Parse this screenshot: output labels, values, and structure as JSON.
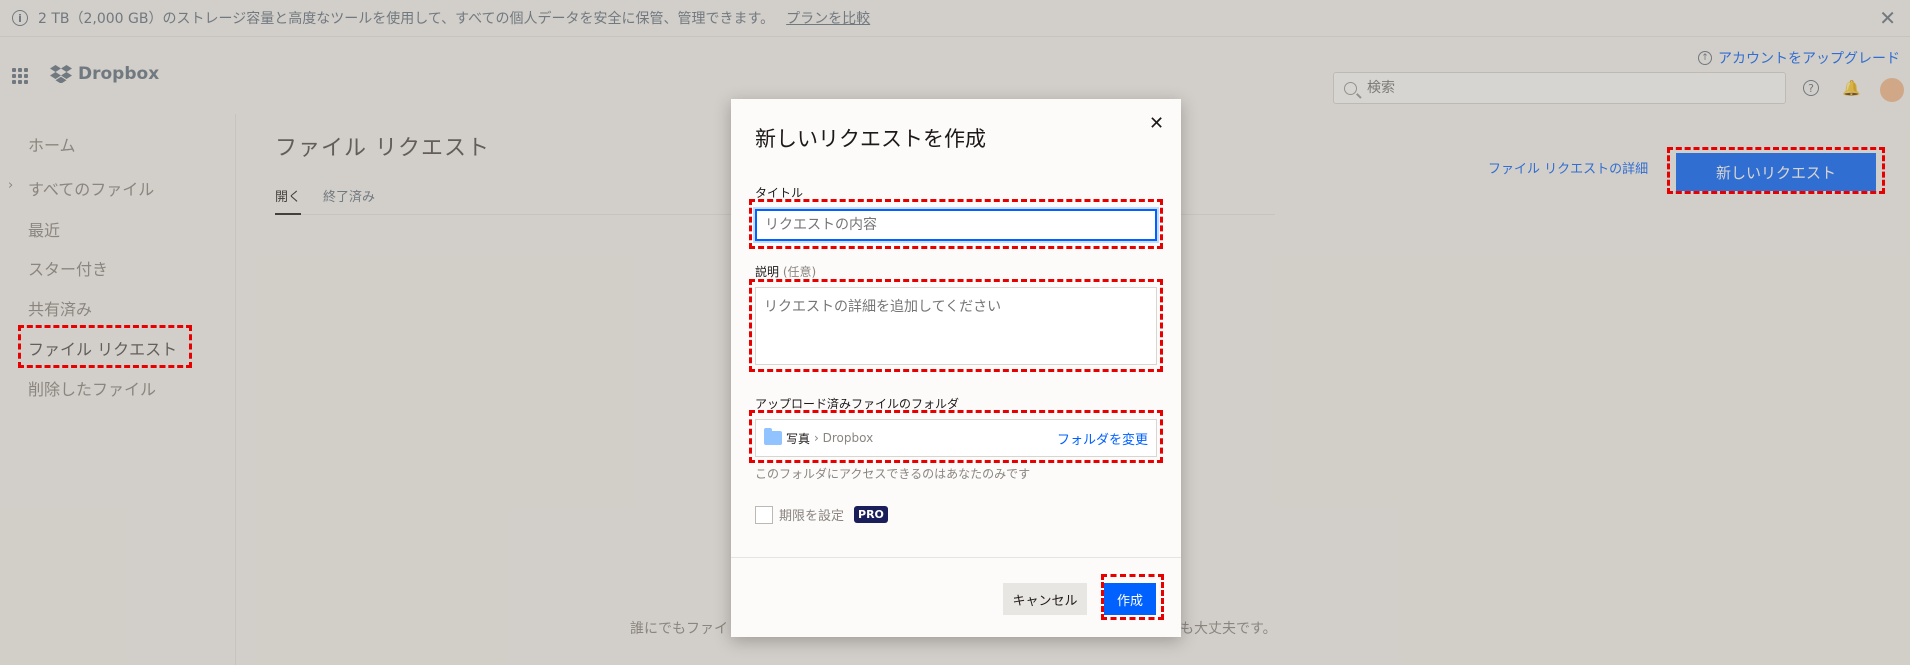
{
  "banner": {
    "text": "2 TB（2,000 GB）のストレージ容量と高度なツールを使用して、すべての個人データを安全に保管、管理できます。",
    "link": "プランを比較",
    "close": "✕"
  },
  "header": {
    "logo": "Dropbox",
    "upgrade": "アカウントをアップグレード",
    "search_placeholder": "検索"
  },
  "sidebar": {
    "items": [
      {
        "label": "ホーム"
      },
      {
        "label": "すべてのファイル"
      },
      {
        "label": "最近"
      },
      {
        "label": "スター付き"
      },
      {
        "label": "共有済み"
      },
      {
        "label": "ファイル リクエスト"
      },
      {
        "label": "削除したファイル"
      }
    ]
  },
  "main": {
    "title": "ファイル リクエスト",
    "tabs": [
      {
        "label": "開く"
      },
      {
        "label": "終了済み"
      }
    ],
    "details_link": "ファイル リクエストの詳細",
    "new_request_button": "新しいリクエスト",
    "footer_left": "誰にでもファイ",
    "footer_right": "も大丈夫です。"
  },
  "modal": {
    "title": "新しいリクエストを作成",
    "close": "✕",
    "title_label": "タイトル",
    "title_placeholder": "リクエストの内容",
    "desc_label": "説明",
    "desc_optional": "(任意)",
    "desc_placeholder": "リクエストの詳細を追加してください",
    "folder_label": "アップロード済みファイルのフォルダ",
    "folder_name": "写真",
    "folder_path": "› Dropbox",
    "change_folder": "フォルダを変更",
    "folder_note": "このフォルダにアクセスできるのはあなたのみです",
    "deadline_label": "期限を設定",
    "pro_badge": "PRO",
    "cancel_button": "キャンセル",
    "create_button": "作成"
  },
  "colors": {
    "accent": "#0061fe",
    "highlight": "#e60000"
  }
}
